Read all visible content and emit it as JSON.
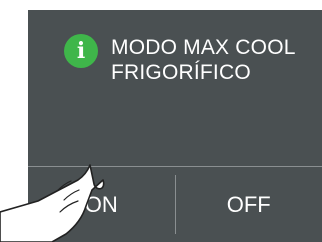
{
  "dialog": {
    "icon": "info-icon",
    "icon_glyph": "i",
    "message_line1": "MODO MAX COOL",
    "message_line2": "FRIGORÍFICO"
  },
  "actions": {
    "on_label": "ON",
    "off_label": "OFF"
  },
  "colors": {
    "panel_bg": "#4a5052",
    "info_green": "#3fb64a",
    "divider": "#8a8f91",
    "text": "#ffffff"
  },
  "overlay": {
    "hand_icon": "pointing-hand-icon"
  }
}
